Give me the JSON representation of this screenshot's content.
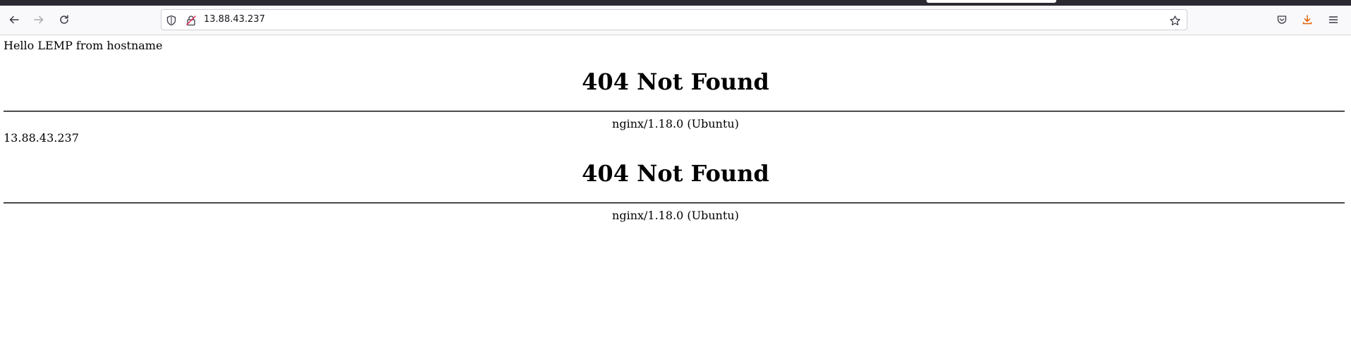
{
  "browser": {
    "url": "13.88.43.237",
    "icons": [
      "back-arrow-icon",
      "forward-arrow-icon",
      "reload-icon",
      "shield-icon",
      "insecure-lock-icon",
      "bookmark-star-icon",
      "pocket-icon",
      "downloads-icon",
      "menu-icon"
    ],
    "colors": {
      "download_accent": "#e66000",
      "insecure_lock": "#e22850"
    }
  },
  "page": {
    "first_line": "Hello LEMP from hostname",
    "section1": {
      "heading": "404 Not Found",
      "footer": "nginx/1.18.0 (Ubuntu)"
    },
    "second_line": "13.88.43.237",
    "section2": {
      "heading": "404 Not Found",
      "footer": "nginx/1.18.0 (Ubuntu)"
    }
  }
}
